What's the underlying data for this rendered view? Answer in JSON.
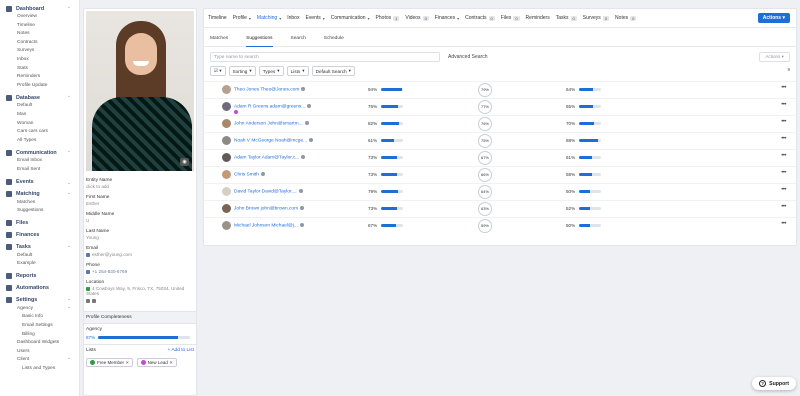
{
  "sidebar": {
    "dashboard": {
      "label": "Dashboard",
      "icon": "dashboard-icon",
      "items": [
        "Overview",
        "Timeline",
        "Notes",
        "Contracts",
        "Surveys",
        "Inbox",
        "Stats",
        "Reminders",
        "Profile Update"
      ]
    },
    "database": {
      "label": "Database",
      "icon": "database-icon",
      "items": [
        "Default",
        "Man",
        "Woman",
        "Cars cars cars",
        "All Types"
      ]
    },
    "communication": {
      "label": "Communication",
      "icon": "chat-icon",
      "items": [
        "Email Inbox",
        "Email Sent"
      ]
    },
    "events": {
      "label": "Events",
      "icon": "calendar-icon"
    },
    "matching": {
      "label": "Matching",
      "icon": "matching-icon",
      "items": [
        "Matches",
        "Suggestions"
      ]
    },
    "files": {
      "label": "Files",
      "icon": "folder-icon"
    },
    "finances": {
      "label": "Finances",
      "icon": "money-icon"
    },
    "tasks": {
      "label": "Tasks",
      "icon": "tasks-icon",
      "items": [
        "Default",
        "Example"
      ]
    },
    "reports": {
      "label": "Reports",
      "icon": "reports-icon"
    },
    "automations": {
      "label": "Automations",
      "icon": "automation-icon"
    },
    "settings": {
      "label": "Settings",
      "icon": "gear-icon",
      "agency": {
        "label": "Agency",
        "items": [
          "Basic Info",
          "Email Settings",
          "Billing"
        ]
      },
      "items": [
        "Dashboard Widgets",
        "Users"
      ],
      "client": {
        "label": "Client",
        "items": [
          "Lists and Types"
        ]
      }
    }
  },
  "profile": {
    "entity_name_label": "Entity Name",
    "entity_name_value": "click to add",
    "first_name_label": "First Name",
    "first_name_value": "Esther",
    "middle_name_label": "Middle Name",
    "middle_name_value": "U",
    "last_name_label": "Last Name",
    "last_name_value": "Young",
    "email_label": "Email",
    "email_value": "esther@young.com",
    "phone_label": "Phone",
    "phone_value": "+1 254-830-6769",
    "location_label": "Location",
    "location_value": "4 Cowboys Way, 9, Frisco, TX, 75034, United States",
    "completeness_label": "Profile Completeness",
    "agency_label": "Agency",
    "agency_pct_text": "87%",
    "agency_pct": 87,
    "lists_label": "Lists",
    "add_to_list": "+ Add to List",
    "tags": [
      {
        "label": "Free Member",
        "color": "#2e9b46"
      },
      {
        "label": "New Lead",
        "color": "#c44ad6"
      }
    ]
  },
  "topnav": [
    {
      "label": "Timeline"
    },
    {
      "label": "Profile",
      "caret": true
    },
    {
      "label": "Matching",
      "caret": true,
      "active": true
    },
    {
      "label": "Inbox"
    },
    {
      "label": "Events",
      "caret": true
    },
    {
      "label": "Communication",
      "caret": true
    },
    {
      "label": "Photos",
      "count": "1"
    },
    {
      "label": "Videos",
      "count": "0"
    },
    {
      "label": "Finances",
      "caret": true
    },
    {
      "label": "Contracts",
      "count": "0"
    },
    {
      "label": "Files",
      "count": "0"
    },
    {
      "label": "Reminders"
    },
    {
      "label": "Tasks",
      "count": "0"
    },
    {
      "label": "Surveys",
      "count": "0"
    },
    {
      "label": "Notes",
      "count": "0"
    }
  ],
  "actions_label": "Actions",
  "subtabs": [
    "Matches",
    "Suggestions",
    "Search",
    "Schedule"
  ],
  "search": {
    "placeholder": "Type name to search",
    "advanced": "Advanced Search",
    "actions": "Actions"
  },
  "filters": {
    "sorting": "Sorting",
    "types": "Types",
    "lists": "Lists",
    "default_search": "Default Search",
    "count": "9"
  },
  "accent": "#1e6ed8",
  "suggestions": [
    {
      "name": "Theo Jones Theo@Jones.com",
      "p1": "94%",
      "v1": 94,
      "score": "79%",
      "p2": "64%",
      "v2": 64,
      "avatar": "#b6a08f",
      "extra_icon": true
    },
    {
      "name": "Adam R Greens adam@greens...",
      "p1": "76%",
      "v1": 76,
      "score": "77%",
      "p2": "65%",
      "v2": 65,
      "avatar": "#6d6b7c",
      "pill": true
    },
    {
      "name": "John Anderson John@smartm...",
      "p1": "82%",
      "v1": 82,
      "score": "76%",
      "p2": "70%",
      "v2": 70,
      "avatar": "#a8876d"
    },
    {
      "name": "Noah V McGeorge Noah@mcge...",
      "p1": "61%",
      "v1": 61,
      "score": "75%",
      "p2": "88%",
      "v2": 88,
      "avatar": "#8c8a86"
    },
    {
      "name": "Adam Taylor Adam@Taylor.c...",
      "p1": "73%",
      "v1": 73,
      "score": "67%",
      "p2": "61%",
      "v2": 61,
      "avatar": "#5f5b57"
    },
    {
      "name": "Chris Smith",
      "p1": "73%",
      "v1": 73,
      "score": "66%",
      "p2": "58%",
      "v2": 58,
      "avatar": "#c39a78"
    },
    {
      "name": "David Taylor David@Taylor....",
      "p1": "79%",
      "v1": 79,
      "score": "64%",
      "p2": "50%",
      "v2": 50,
      "avatar": "#d7cfc3"
    },
    {
      "name": "John Brown john@brown.com",
      "p1": "73%",
      "v1": 73,
      "score": "63%",
      "p2": "52%",
      "v2": 52,
      "avatar": "#7b6455"
    },
    {
      "name": "Michael Johnson Michael@j...",
      "p1": "67%",
      "v1": 67,
      "score": "59%",
      "p2": "50%",
      "v2": 50,
      "avatar": "#9b928a"
    }
  ],
  "support_label": "Support"
}
